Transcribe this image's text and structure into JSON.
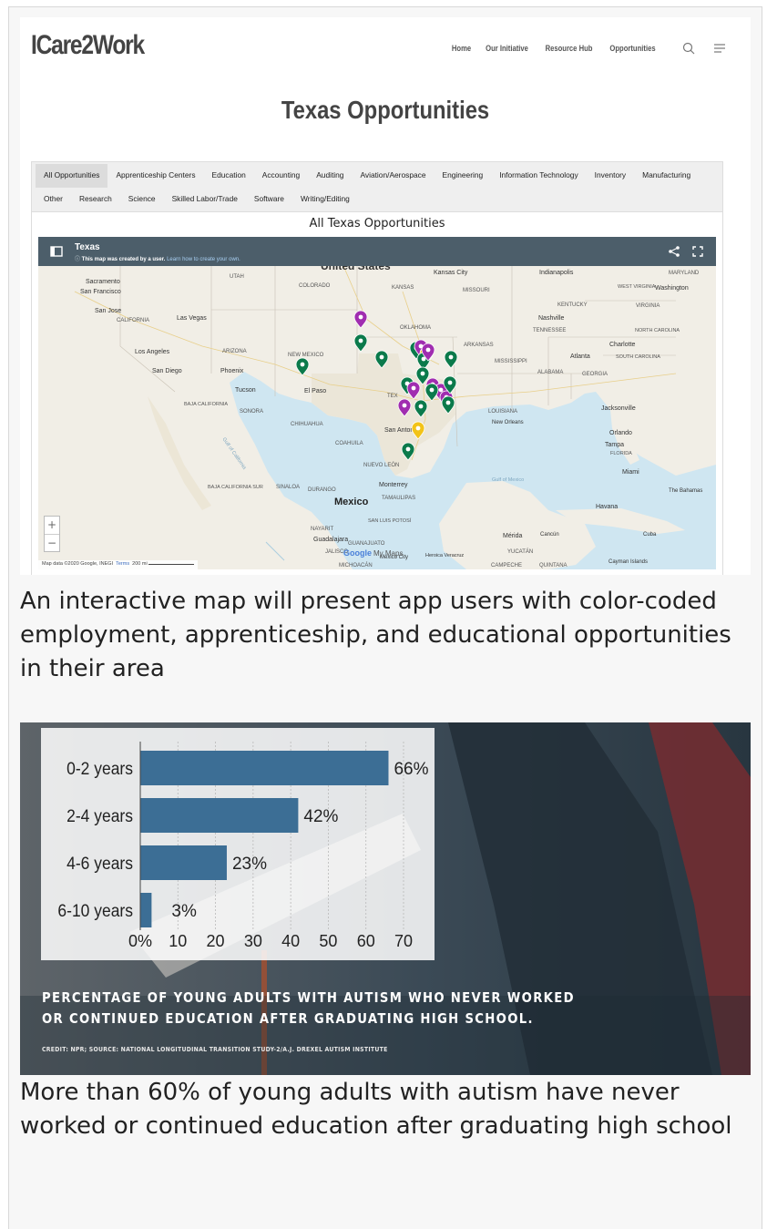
{
  "site": {
    "logo": "ICare2Work",
    "nav": [
      "Home",
      "Our Initiative",
      "Resource Hub",
      "Opportunities"
    ]
  },
  "page_title": "Texas Opportunities",
  "categories": {
    "row1": [
      "All Opportunities",
      "Apprenticeship Centers",
      "Education",
      "Accounting",
      "Auditing",
      "Aviation/Aerospace",
      "Engineering",
      "Information Technology",
      "Inventory",
      "Manufacturing"
    ],
    "row2": [
      "Other",
      "Research",
      "Science",
      "Skilled Labor/Trade",
      "Software",
      "Writing/Editing"
    ],
    "active": "All Opportunities"
  },
  "embed_title": "All Texas Opportunities",
  "map": {
    "title": "Texas",
    "notice_bold": "This map was created by a user.",
    "notice_link": "Learn how to create your own.",
    "attribution": "Map data ©2020 Google, INEGI",
    "terms": "Terms",
    "scale": "200 mi",
    "zoom_in": "+",
    "zoom_out": "−",
    "labels": {
      "us": "United States",
      "mexico": "Mexico",
      "gulf": "Gulf of Mexico",
      "google": "Google",
      "mymaps": "My Maps",
      "sacramento": "Sacramento",
      "sf": "San Francisco",
      "sanjose": "San Jose",
      "california": "CALIFORNIA",
      "lasvegas": "Las Vegas",
      "la": "Los Angeles",
      "sandiego": "San Diego",
      "phoenix": "Phoenix",
      "tucson": "Tucson",
      "arizona": "ARIZONA",
      "utah": "UTAH",
      "colorado": "COLORADO",
      "kansas": "KANSAS",
      "kansascity": "Kansas City",
      "missouri": "MISSOURI",
      "indianapolis": "Indianapolis",
      "maryland": "MARYLAND",
      "washington": "Washington",
      "westvirginia": "WEST VIRGINIA",
      "virginia": "VIRGINIA",
      "kentucky": "KENTUCKY",
      "nashville": "Nashville",
      "tennessee": "TENNESSEE",
      "northcarolina": "NORTH CAROLINA",
      "charlotte": "Charlotte",
      "southcarolina": "SOUTH CAROLINA",
      "atlanta": "Atlanta",
      "georgia": "GEORGIA",
      "alabama": "ALABAMA",
      "mississippi": "MISSISSIPPI",
      "arkansas": "ARKANSAS",
      "oklahoma": "OKLAHOMA",
      "newmexico": "NEW MEXICO",
      "elpaso": "El Paso",
      "texas": "TEX",
      "louisiana": "LOUISIANA",
      "neworleans": "New Orleans",
      "jacksonville": "Jacksonville",
      "orlando": "Orlando",
      "tampa": "Tampa",
      "florida": "FLORIDA",
      "miami": "Miami",
      "bahamas": "The Bahamas",
      "havana": "Havana",
      "cuba": "Cuba",
      "sanantonio": "San Antonio",
      "bajacal": "BAJA CALIFORNIA",
      "sonora": "SONORA",
      "chihuahua": "CHIHUAHUA",
      "coahuila": "COAHUILA",
      "nuevoleon": "NUEVO LEÓN",
      "monterrey": "Monterrey",
      "tamaulipas": "TAMAULIPAS",
      "sinaloa": "SINALOA",
      "durango": "DURANGO",
      "bajasur": "BAJA CALIFORNIA SUR",
      "sanluis": "SAN LUIS POTOSÍ",
      "nayarit": "NAYARIT",
      "guadalajara": "Guadalajara",
      "guanajuato": "GUANAJUATO",
      "jalisco": "JALISCO",
      "mexicocity": "México City",
      "heroica": "Heroica Veracruz",
      "michoacan": "MICHOACÁN",
      "merida": "Mérida",
      "cancun": "Cancún",
      "yucatan": "YUCATÁN",
      "campeche": "CAMPECHE",
      "quintana": "QUINTANA",
      "cayman": "Cayman Islands",
      "gulfcal": "Gulf of California"
    },
    "marker_colors": {
      "green": "#0b7a4b",
      "purple": "#a02db0",
      "yellow": "#f2c318"
    }
  },
  "caption1": "An interactive map will present app users with color-coded employment, apprenticeship, and educational opportunities in their area",
  "chart_data": {
    "type": "bar",
    "orientation": "horizontal",
    "categories": [
      "0-2 years",
      "2-4 years",
      "4-6 years",
      "6-10 years"
    ],
    "values": [
      66,
      42,
      23,
      3
    ],
    "data_labels": [
      "66%",
      "42%",
      "23%",
      "3%"
    ],
    "x_ticks": [
      "0%",
      "10",
      "20",
      "30",
      "40",
      "50",
      "60",
      "70"
    ],
    "xlim": [
      0,
      70
    ],
    "grid": true,
    "bar_color": "#3c6e95",
    "title": "PERCENTAGE OF YOUNG ADULTS WITH AUTISM WHO NEVER WORKED OR CONTINUED EDUCATION AFTER GRADUATING HIGH SCHOOL.",
    "credit": "CREDIT: NPR; SOURCE: NATIONAL LONGITUDINAL TRANSITION STUDY-2/A.J. DREXEL AUTISM INSTITUTE"
  },
  "banner": {
    "line1": "PERCENTAGE OF YOUNG ADULTS WITH AUTISM WHO NEVER WORKED",
    "line2": "OR CONTINUED EDUCATION AFTER GRADUATING HIGH SCHOOL."
  },
  "caption2": "More than 60% of young adults with autism have never worked or continued education after graduating high school"
}
